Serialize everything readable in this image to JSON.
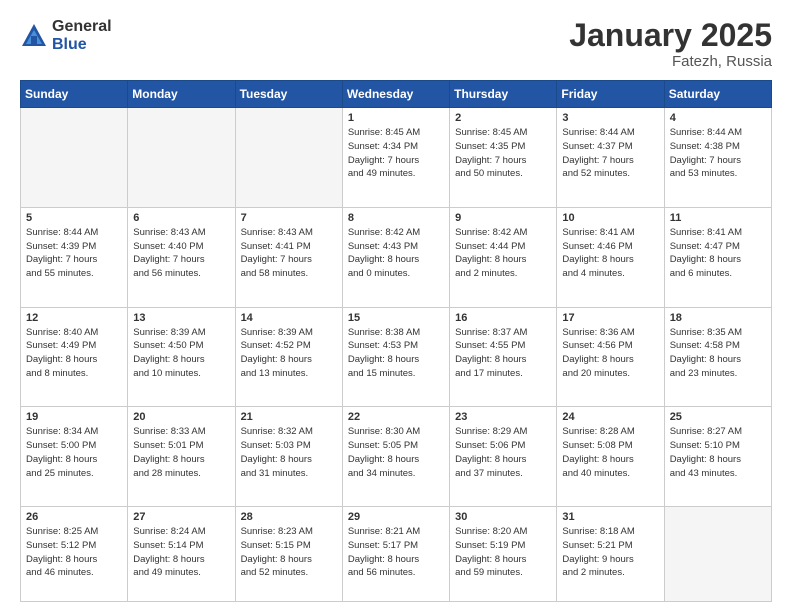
{
  "header": {
    "logo_general": "General",
    "logo_blue": "Blue",
    "month_title": "January 2025",
    "location": "Fatezh, Russia"
  },
  "weekdays": [
    "Sunday",
    "Monday",
    "Tuesday",
    "Wednesday",
    "Thursday",
    "Friday",
    "Saturday"
  ],
  "weeks": [
    [
      {
        "day": "",
        "info": "",
        "empty": true
      },
      {
        "day": "",
        "info": "",
        "empty": true
      },
      {
        "day": "",
        "info": "",
        "empty": true
      },
      {
        "day": "1",
        "info": "Sunrise: 8:45 AM\nSunset: 4:34 PM\nDaylight: 7 hours\nand 49 minutes.",
        "empty": false
      },
      {
        "day": "2",
        "info": "Sunrise: 8:45 AM\nSunset: 4:35 PM\nDaylight: 7 hours\nand 50 minutes.",
        "empty": false
      },
      {
        "day": "3",
        "info": "Sunrise: 8:44 AM\nSunset: 4:37 PM\nDaylight: 7 hours\nand 52 minutes.",
        "empty": false
      },
      {
        "day": "4",
        "info": "Sunrise: 8:44 AM\nSunset: 4:38 PM\nDaylight: 7 hours\nand 53 minutes.",
        "empty": false
      }
    ],
    [
      {
        "day": "5",
        "info": "Sunrise: 8:44 AM\nSunset: 4:39 PM\nDaylight: 7 hours\nand 55 minutes.",
        "empty": false
      },
      {
        "day": "6",
        "info": "Sunrise: 8:43 AM\nSunset: 4:40 PM\nDaylight: 7 hours\nand 56 minutes.",
        "empty": false
      },
      {
        "day": "7",
        "info": "Sunrise: 8:43 AM\nSunset: 4:41 PM\nDaylight: 7 hours\nand 58 minutes.",
        "empty": false
      },
      {
        "day": "8",
        "info": "Sunrise: 8:42 AM\nSunset: 4:43 PM\nDaylight: 8 hours\nand 0 minutes.",
        "empty": false
      },
      {
        "day": "9",
        "info": "Sunrise: 8:42 AM\nSunset: 4:44 PM\nDaylight: 8 hours\nand 2 minutes.",
        "empty": false
      },
      {
        "day": "10",
        "info": "Sunrise: 8:41 AM\nSunset: 4:46 PM\nDaylight: 8 hours\nand 4 minutes.",
        "empty": false
      },
      {
        "day": "11",
        "info": "Sunrise: 8:41 AM\nSunset: 4:47 PM\nDaylight: 8 hours\nand 6 minutes.",
        "empty": false
      }
    ],
    [
      {
        "day": "12",
        "info": "Sunrise: 8:40 AM\nSunset: 4:49 PM\nDaylight: 8 hours\nand 8 minutes.",
        "empty": false
      },
      {
        "day": "13",
        "info": "Sunrise: 8:39 AM\nSunset: 4:50 PM\nDaylight: 8 hours\nand 10 minutes.",
        "empty": false
      },
      {
        "day": "14",
        "info": "Sunrise: 8:39 AM\nSunset: 4:52 PM\nDaylight: 8 hours\nand 13 minutes.",
        "empty": false
      },
      {
        "day": "15",
        "info": "Sunrise: 8:38 AM\nSunset: 4:53 PM\nDaylight: 8 hours\nand 15 minutes.",
        "empty": false
      },
      {
        "day": "16",
        "info": "Sunrise: 8:37 AM\nSunset: 4:55 PM\nDaylight: 8 hours\nand 17 minutes.",
        "empty": false
      },
      {
        "day": "17",
        "info": "Sunrise: 8:36 AM\nSunset: 4:56 PM\nDaylight: 8 hours\nand 20 minutes.",
        "empty": false
      },
      {
        "day": "18",
        "info": "Sunrise: 8:35 AM\nSunset: 4:58 PM\nDaylight: 8 hours\nand 23 minutes.",
        "empty": false
      }
    ],
    [
      {
        "day": "19",
        "info": "Sunrise: 8:34 AM\nSunset: 5:00 PM\nDaylight: 8 hours\nand 25 minutes.",
        "empty": false
      },
      {
        "day": "20",
        "info": "Sunrise: 8:33 AM\nSunset: 5:01 PM\nDaylight: 8 hours\nand 28 minutes.",
        "empty": false
      },
      {
        "day": "21",
        "info": "Sunrise: 8:32 AM\nSunset: 5:03 PM\nDaylight: 8 hours\nand 31 minutes.",
        "empty": false
      },
      {
        "day": "22",
        "info": "Sunrise: 8:30 AM\nSunset: 5:05 PM\nDaylight: 8 hours\nand 34 minutes.",
        "empty": false
      },
      {
        "day": "23",
        "info": "Sunrise: 8:29 AM\nSunset: 5:06 PM\nDaylight: 8 hours\nand 37 minutes.",
        "empty": false
      },
      {
        "day": "24",
        "info": "Sunrise: 8:28 AM\nSunset: 5:08 PM\nDaylight: 8 hours\nand 40 minutes.",
        "empty": false
      },
      {
        "day": "25",
        "info": "Sunrise: 8:27 AM\nSunset: 5:10 PM\nDaylight: 8 hours\nand 43 minutes.",
        "empty": false
      }
    ],
    [
      {
        "day": "26",
        "info": "Sunrise: 8:25 AM\nSunset: 5:12 PM\nDaylight: 8 hours\nand 46 minutes.",
        "empty": false
      },
      {
        "day": "27",
        "info": "Sunrise: 8:24 AM\nSunset: 5:14 PM\nDaylight: 8 hours\nand 49 minutes.",
        "empty": false
      },
      {
        "day": "28",
        "info": "Sunrise: 8:23 AM\nSunset: 5:15 PM\nDaylight: 8 hours\nand 52 minutes.",
        "empty": false
      },
      {
        "day": "29",
        "info": "Sunrise: 8:21 AM\nSunset: 5:17 PM\nDaylight: 8 hours\nand 56 minutes.",
        "empty": false
      },
      {
        "day": "30",
        "info": "Sunrise: 8:20 AM\nSunset: 5:19 PM\nDaylight: 8 hours\nand 59 minutes.",
        "empty": false
      },
      {
        "day": "31",
        "info": "Sunrise: 8:18 AM\nSunset: 5:21 PM\nDaylight: 9 hours\nand 2 minutes.",
        "empty": false
      },
      {
        "day": "",
        "info": "",
        "empty": true
      }
    ]
  ]
}
